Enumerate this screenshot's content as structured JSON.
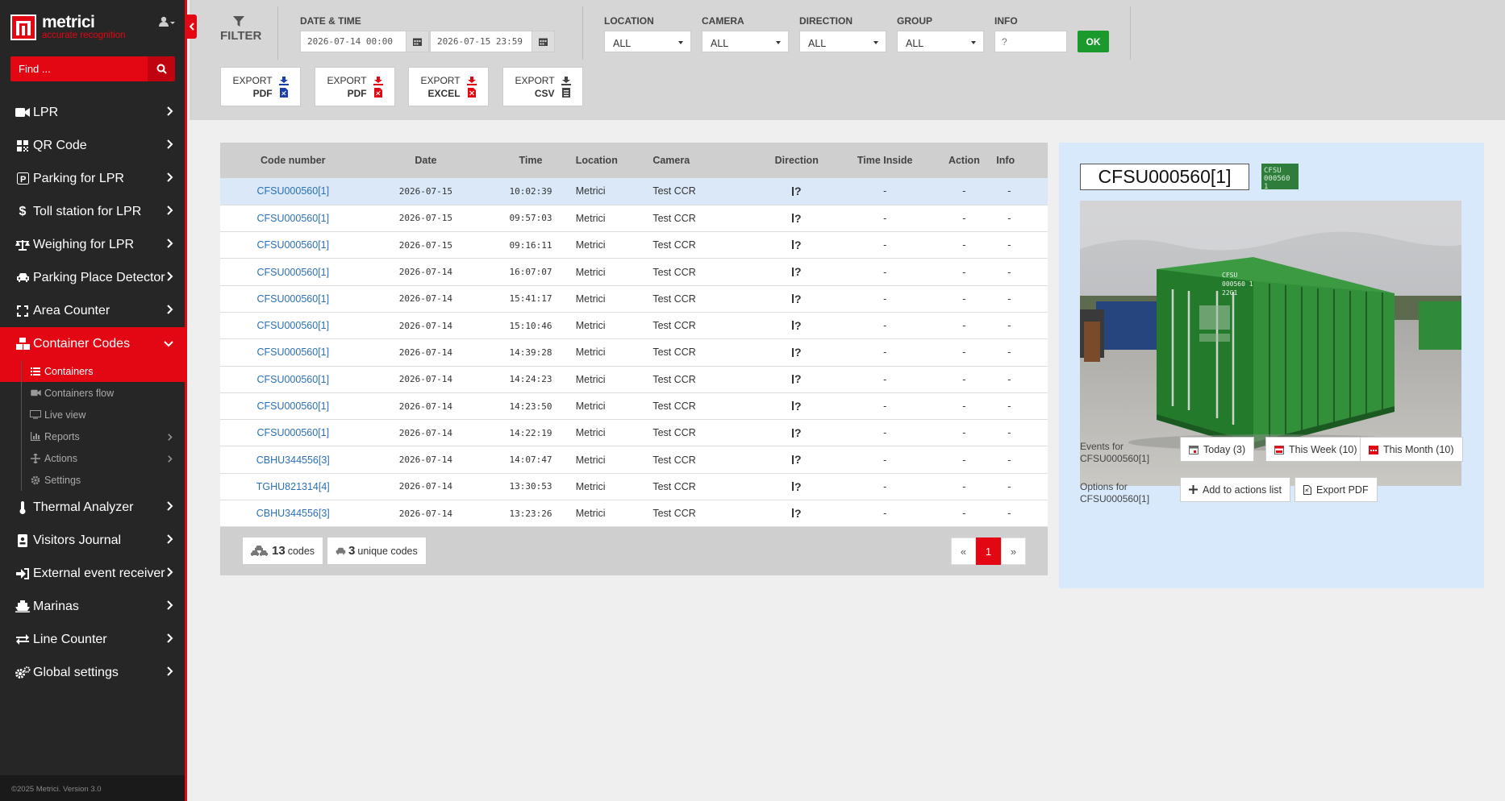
{
  "sidebar": {
    "brand_name": "metrici",
    "brand_tagline": "accurate recognition",
    "search_placeholder": "Find ...",
    "items": [
      {
        "label": "LPR",
        "icon": "video-camera-icon"
      },
      {
        "label": "QR Code",
        "icon": "qr-code-icon"
      },
      {
        "label": "Parking for LPR",
        "icon": "parking-icon"
      },
      {
        "label": "Toll station for LPR",
        "icon": "dollar-icon"
      },
      {
        "label": "Weighing for LPR",
        "icon": "scale-icon"
      },
      {
        "label": "Parking Place Detector",
        "icon": "car-icon"
      },
      {
        "label": "Area Counter",
        "icon": "expand-icon"
      },
      {
        "label": "Container Codes",
        "icon": "boxes-icon"
      },
      {
        "label": "Thermal Analyzer",
        "icon": "thermometer-icon"
      },
      {
        "label": "Visitors Journal",
        "icon": "id-badge-icon"
      },
      {
        "label": "External event receiver",
        "icon": "sign-in-icon"
      },
      {
        "label": "Marinas",
        "icon": "ship-icon"
      },
      {
        "label": "Line Counter",
        "icon": "exchange-icon"
      },
      {
        "label": "Global settings",
        "icon": "cogs-icon"
      }
    ],
    "subitems": [
      {
        "label": "Containers"
      },
      {
        "label": "Containers flow"
      },
      {
        "label": "Live view"
      },
      {
        "label": "Reports"
      },
      {
        "label": "Actions"
      },
      {
        "label": "Settings"
      }
    ],
    "footer": "©2025 Metrici. Version 3.0"
  },
  "filter": {
    "title": "FILTER",
    "date_label": "DATE & TIME",
    "date_from": "2026-07-14 00:00",
    "date_to": "2026-07-15 23:59",
    "location_label": "LOCATION",
    "location_value": "ALL",
    "camera_label": "CAMERA",
    "camera_value": "ALL",
    "direction_label": "DIRECTION",
    "direction_value": "ALL",
    "group_label": "GROUP",
    "group_value": "ALL",
    "info_label": "INFO",
    "info_placeholder": "?",
    "ok_label": "OK"
  },
  "exports": [
    {
      "top": "EXPORT",
      "bottom": "PDF"
    },
    {
      "top": "EXPORT",
      "bottom": "PDF"
    },
    {
      "top": "EXPORT",
      "bottom": "EXCEL"
    },
    {
      "top": "EXPORT",
      "bottom": "CSV"
    }
  ],
  "table": {
    "headers": [
      "Code number",
      "Date",
      "Time",
      "Location",
      "Camera",
      "Direction",
      "Time Inside",
      "Action",
      "Info"
    ],
    "rows": [
      {
        "code": "CFSU000560[1]",
        "date": "2026-07-15",
        "time": "10:02:39",
        "location": "Metrici",
        "camera": "Test CCR",
        "direction": "?",
        "inside": "-",
        "action": "-",
        "info": "-"
      },
      {
        "code": "CFSU000560[1]",
        "date": "2026-07-15",
        "time": "09:57:03",
        "location": "Metrici",
        "camera": "Test CCR",
        "direction": "?",
        "inside": "-",
        "action": "-",
        "info": "-"
      },
      {
        "code": "CFSU000560[1]",
        "date": "2026-07-15",
        "time": "09:16:11",
        "location": "Metrici",
        "camera": "Test CCR",
        "direction": "?",
        "inside": "-",
        "action": "-",
        "info": "-"
      },
      {
        "code": "CFSU000560[1]",
        "date": "2026-07-14",
        "time": "16:07:07",
        "location": "Metrici",
        "camera": "Test CCR",
        "direction": "?",
        "inside": "-",
        "action": "-",
        "info": "-"
      },
      {
        "code": "CFSU000560[1]",
        "date": "2026-07-14",
        "time": "15:41:17",
        "location": "Metrici",
        "camera": "Test CCR",
        "direction": "?",
        "inside": "-",
        "action": "-",
        "info": "-"
      },
      {
        "code": "CFSU000560[1]",
        "date": "2026-07-14",
        "time": "15:10:46",
        "location": "Metrici",
        "camera": "Test CCR",
        "direction": "?",
        "inside": "-",
        "action": "-",
        "info": "-"
      },
      {
        "code": "CFSU000560[1]",
        "date": "2026-07-14",
        "time": "14:39:28",
        "location": "Metrici",
        "camera": "Test CCR",
        "direction": "?",
        "inside": "-",
        "action": "-",
        "info": "-"
      },
      {
        "code": "CFSU000560[1]",
        "date": "2026-07-14",
        "time": "14:24:23",
        "location": "Metrici",
        "camera": "Test CCR",
        "direction": "?",
        "inside": "-",
        "action": "-",
        "info": "-"
      },
      {
        "code": "CFSU000560[1]",
        "date": "2026-07-14",
        "time": "14:23:50",
        "location": "Metrici",
        "camera": "Test CCR",
        "direction": "?",
        "inside": "-",
        "action": "-",
        "info": "-"
      },
      {
        "code": "CFSU000560[1]",
        "date": "2026-07-14",
        "time": "14:22:19",
        "location": "Metrici",
        "camera": "Test CCR",
        "direction": "?",
        "inside": "-",
        "action": "-",
        "info": "-"
      },
      {
        "code": "CBHU344556[3]",
        "date": "2026-07-14",
        "time": "14:07:47",
        "location": "Metrici",
        "camera": "Test CCR",
        "direction": "?",
        "inside": "-",
        "action": "-",
        "info": "-"
      },
      {
        "code": "TGHU821314[4]",
        "date": "2026-07-14",
        "time": "13:30:53",
        "location": "Metrici",
        "camera": "Test CCR",
        "direction": "?",
        "inside": "-",
        "action": "-",
        "info": "-"
      },
      {
        "code": "CBHU344556[3]",
        "date": "2026-07-14",
        "time": "13:23:26",
        "location": "Metrici",
        "camera": "Test CCR",
        "direction": "?",
        "inside": "-",
        "action": "-",
        "info": "-"
      }
    ]
  },
  "summary": {
    "codes_count": "13",
    "codes_label": "codes",
    "unique_count": "3",
    "unique_label": "unique codes"
  },
  "pager": {
    "first": "«",
    "current": "1",
    "last": "»"
  },
  "detail": {
    "code": "CFSU000560[1]",
    "thumb_line1": "CFSU",
    "thumb_line2": "000560 1",
    "container_text1": "CFSU",
    "container_text2": "000560 1",
    "container_text3": "22G1",
    "events_label": "Events for",
    "events_code": "CFSU000560[1]",
    "today": "Today (3)",
    "week": "This Week (10)",
    "month": "This Month (10)",
    "options_label": "Options for",
    "options_code": "CFSU000560[1]",
    "add_action": "Add to actions list",
    "export_pdf": "Export PDF"
  },
  "colors": {
    "brand": "#e30613",
    "ok": "#1a9a2c",
    "link": "#2a70b8",
    "container": "#2f7d3b"
  }
}
